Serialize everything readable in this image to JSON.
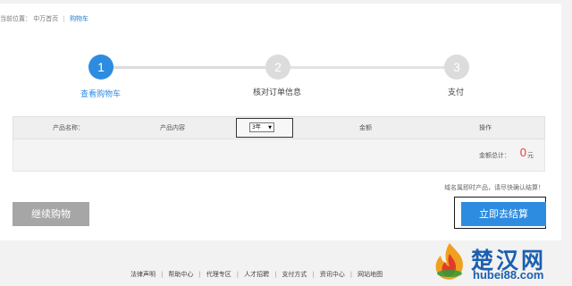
{
  "breadcrumb": {
    "prefix": "当前位置：",
    "home": "中万首页",
    "current": "购物车"
  },
  "steps": [
    {
      "number": "1",
      "label": "查看购物车",
      "state": "active"
    },
    {
      "number": "2",
      "label": "核对订单信息",
      "state": "todo"
    },
    {
      "number": "3",
      "label": "支付",
      "state": "todo"
    }
  ],
  "table": {
    "headers": [
      "产品名称：",
      "产品内容",
      "金额",
      "操作"
    ],
    "period_selected": "3年"
  },
  "total": {
    "label": "金额总计：",
    "value": "0",
    "unit": "元"
  },
  "notice": "域名属即时产品，请尽快确认结算！",
  "buttons": {
    "continue": "继续购物",
    "checkout": "立即去结算"
  },
  "footer": {
    "links": [
      "法律声明",
      "帮助中心",
      "代理专区",
      "人才招聘",
      "支付方式",
      "资讯中心",
      "网站地图"
    ]
  },
  "watermark": {
    "name": "楚汉网",
    "domain": "hubei88.com"
  },
  "colors": {
    "accent": "#2d8ce0",
    "price": "#e4393c",
    "button_gray": "#a6a6a6"
  }
}
